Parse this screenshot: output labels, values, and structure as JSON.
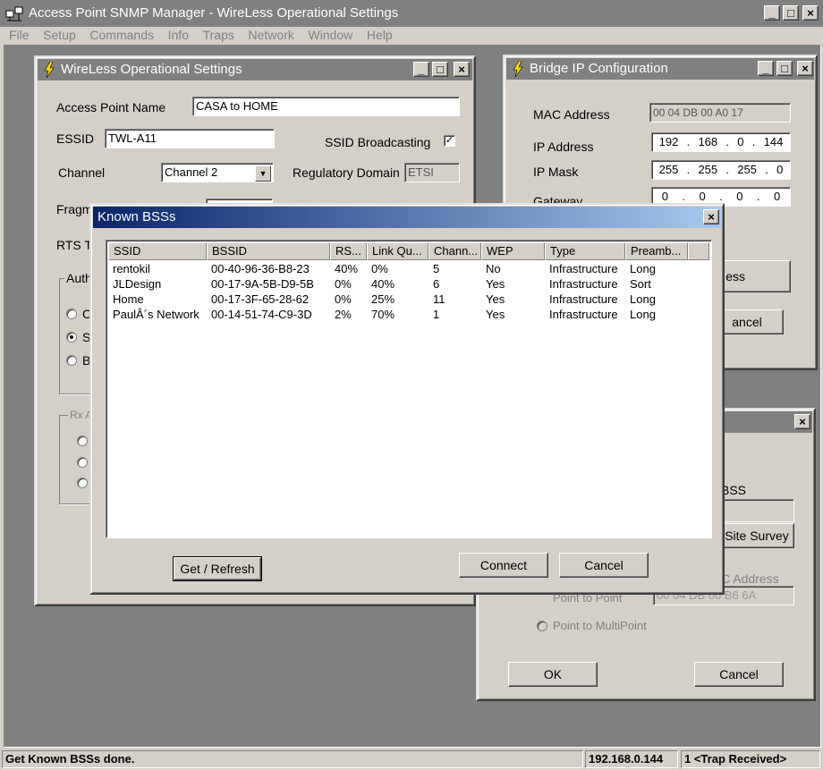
{
  "app": {
    "title": "Access Point SNMP Manager -  WireLess Operational Settings",
    "menu": [
      "File",
      "Setup",
      "Commands",
      "Info",
      "Traps",
      "Network",
      "Window",
      "Help"
    ]
  },
  "caption_buttons": {
    "minimize": "_",
    "maximize": "□",
    "close": "×"
  },
  "wireless_window": {
    "title": "WireLess Operational Settings",
    "ap_name_label": "Access Point Name",
    "ap_name_value": "CASA to HOME",
    "essid_label": "ESSID",
    "essid_value": "TWL-A11",
    "ssid_broadcast_label": "SSID Broadcasting",
    "ssid_broadcast_checked": true,
    "channel_label": "Channel",
    "channel_value": "Channel 2",
    "regdomain_label": "Regulatory Domain",
    "regdomain_value": "ETSI",
    "frag_label": "Fragm",
    "rts_label": "RTS T",
    "auth_group_label": "Auth",
    "auth_options": [
      "C",
      "S",
      "B"
    ],
    "rx_group_label": "Rx A"
  },
  "bridge_window": {
    "title": "Bridge IP Configuration",
    "mac_label": "MAC Address",
    "mac_value": "00 04 DB 00 A0 17",
    "ip_label": "IP Address",
    "ip_value": [
      "192",
      "168",
      "0",
      "144"
    ],
    "mask_label": "IP Mask",
    "mask_value": [
      "255",
      "255",
      "255",
      "0"
    ],
    "gateway_label": "Gateway",
    "gateway_value": [
      "0",
      "0",
      "0",
      "0"
    ],
    "partial_button": "ess",
    "cancel_partial": "ancel"
  },
  "third_window": {
    "bss_label": "BSS",
    "site_survey_partial": "Site Survey",
    "mac_partial": "C Address",
    "mac_value_partial": "00 04 DB 00 B6 6A",
    "radio_p2p": "Point to Point",
    "radio_p2mp": "Point to MultiPoint",
    "ok_label": "OK",
    "cancel_label": "Cancel"
  },
  "dialog": {
    "title": "Known BSSs",
    "columns": [
      "SSID",
      "BSSID",
      "RS...",
      "Link Qu...",
      "Chann...",
      "WEP",
      "Type",
      "Preamb..."
    ],
    "rows": [
      [
        "rentokil",
        "00-40-96-36-B8-23",
        "40%",
        "0%",
        "5",
        "No",
        "Infrastructure",
        "Long"
      ],
      [
        "JLDesign",
        "00-17-9A-5B-D9-5B",
        "0%",
        "40%",
        "6",
        "Yes",
        "Infrastructure",
        "Sort"
      ],
      [
        "Home",
        "00-17-3F-65-28-62",
        "0%",
        "25%",
        "11",
        "Yes",
        "Infrastructure",
        "Long"
      ],
      [
        "PaulÂ´s Network",
        "00-14-51-74-C9-3D",
        "2%",
        "70%",
        "1",
        "Yes",
        "Infrastructure",
        "Long"
      ]
    ],
    "refresh_label": "Get / Refresh",
    "connect_label": "Connect",
    "cancel_label": "Cancel"
  },
  "statusbar": {
    "message": "Get Known BSSs done.",
    "ip": "192.168.0.144",
    "traps": "1 <Trap Received>"
  }
}
